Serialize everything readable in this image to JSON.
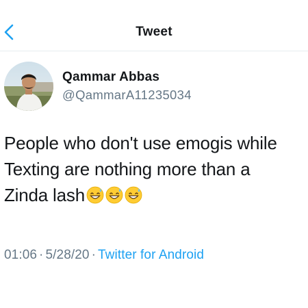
{
  "header": {
    "back_icon": "chevron-left-icon",
    "title": "Tweet",
    "accent_color": "#1da1f2"
  },
  "author": {
    "avatar_icon": "user-avatar",
    "display_name": "Qammar Abbas",
    "handle": "@QammarA11235034"
  },
  "tweet": {
    "lines": [
      "People who don't use emogis while",
      "Texting are nothing more than a",
      "Zinda lash"
    ],
    "emojis": [
      "grinning-face-with-sweat-icon",
      "grinning-face-with-sweat-icon",
      "grinning-face-with-sweat-icon"
    ]
  },
  "meta": {
    "time": "01:06",
    "separator": "·",
    "date": "5/28/20",
    "source": "Twitter for Android",
    "source_color": "#1da1f2",
    "muted_color": "#657786"
  }
}
